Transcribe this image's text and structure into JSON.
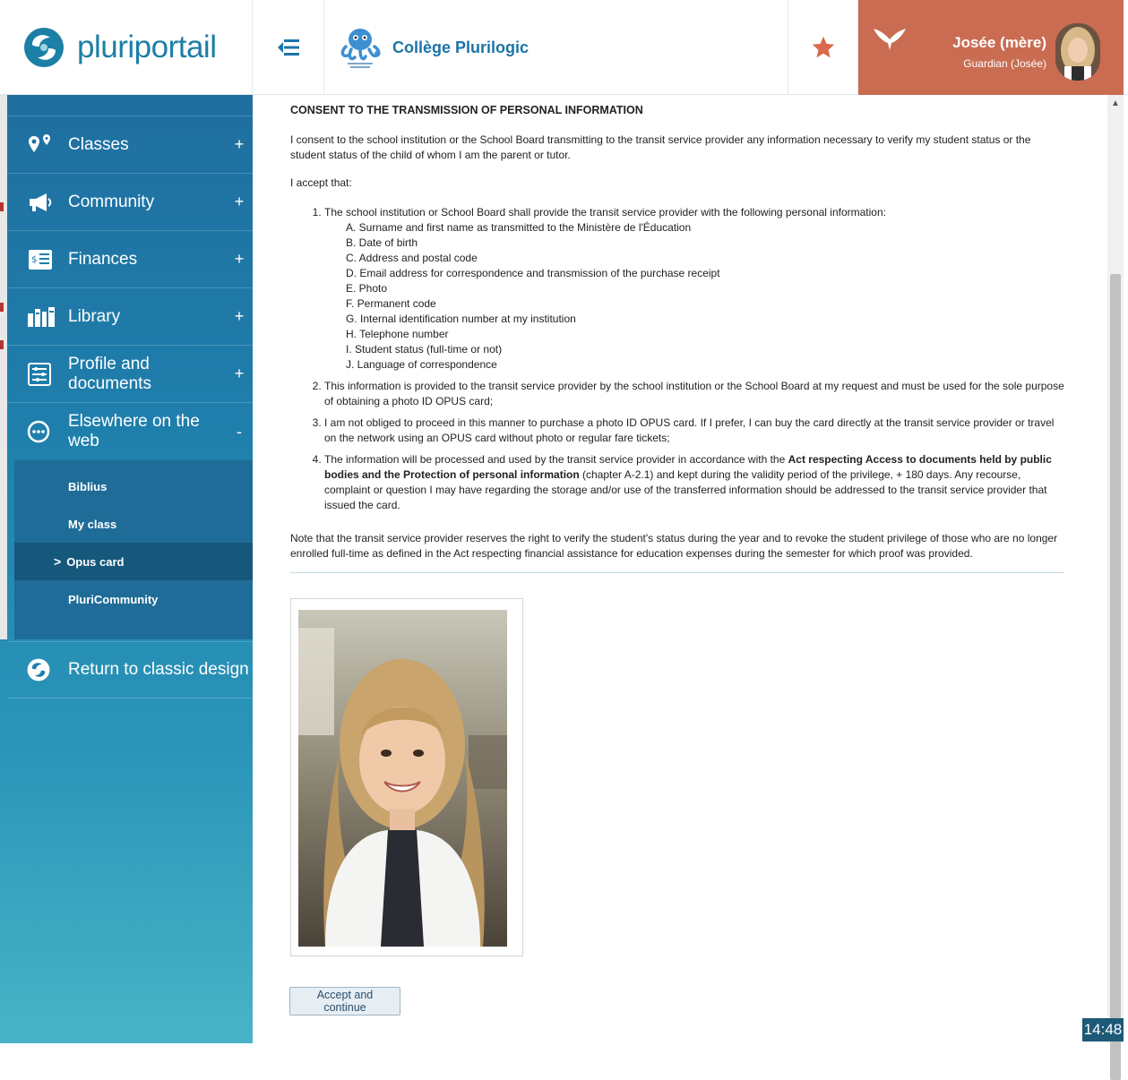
{
  "header": {
    "logo_text": "pluriportail",
    "school_name": "Collège Plurilogic",
    "user_name": "Josée (mère)",
    "user_role": "Guardian (Josée)",
    "colors": {
      "brand": "#1c7fa5",
      "user_panel": "#c96c52",
      "favorite": "#d9694a"
    }
  },
  "sidebar": {
    "items": [
      {
        "label": "Classes",
        "toggle": "+",
        "icon": "map-pin-icon"
      },
      {
        "label": "Community",
        "toggle": "+",
        "icon": "megaphone-icon"
      },
      {
        "label": "Finances",
        "toggle": "+",
        "icon": "invoice-icon"
      },
      {
        "label": "Library",
        "toggle": "+",
        "icon": "books-icon"
      },
      {
        "label": "Profile and documents",
        "toggle": "+",
        "icon": "settings-sliders-icon"
      },
      {
        "label": "Elsewhere on the web",
        "toggle": "-",
        "icon": "ellipsis-circle-icon"
      }
    ],
    "subitems": [
      {
        "label": "Biblius",
        "active": false
      },
      {
        "label": "My class",
        "active": false
      },
      {
        "label": "Opus card",
        "active": true
      },
      {
        "label": "PluriCommunity",
        "active": false
      }
    ],
    "active_marker": ">",
    "return_label": "Return to classic design"
  },
  "content": {
    "title": "CONSENT TO THE TRANSMISSION OF PERSONAL INFORMATION",
    "intro": "I consent to the school institution or the School Board transmitting to the transit service provider any information necessary to verify my student status or the student status of the child of whom I am the parent or tutor.",
    "accept_intro": "I accept that:",
    "item1": "The school institution or School Board shall provide the transit service provider with the following personal information:",
    "subitems": [
      "A. Surname and first name as transmitted to the Ministère de l'Éducation",
      "B. Date of birth",
      "C. Address and postal code",
      "D. Email address for correspondence and transmission of the purchase receipt",
      "E. Photo",
      "F. Permanent code",
      "G. Internal identification number at my institution",
      "H. Telephone number",
      "I. Student status (full-time or not)",
      "J. Language of correspondence"
    ],
    "item2": "This information is provided to the transit service provider by the school institution or the School Board at my request and must be used for the sole purpose of obtaining a photo ID OPUS card;",
    "item3": "I am not obliged to proceed in this manner to purchase a photo ID OPUS card. If I prefer, I can buy the card directly at the transit service provider or travel on the network using an OPUS card without photo or regular fare tickets;",
    "item4_pre": "The information will be processed and used by the transit service provider in accordance with the ",
    "item4_bold": "Act respecting Access to documents held by public bodies and the Protection of personal information",
    "item4_post": " (chapter A-2.1) and kept during the validity period of the privilege, + 180 days. Any recourse, complaint or question I may have regarding the storage and/or use of the transferred information should be addressed to the transit service provider that issued the card.",
    "note": "Note that the transit service provider reserves the right to verify the student's status during the year and to revoke the student privilege of those who are no longer enrolled full-time as defined in the Act respecting financial assistance for education expenses during the semester for which proof was provided.",
    "accept_button": "Accept and continue"
  },
  "status": {
    "clock": "14:48"
  }
}
